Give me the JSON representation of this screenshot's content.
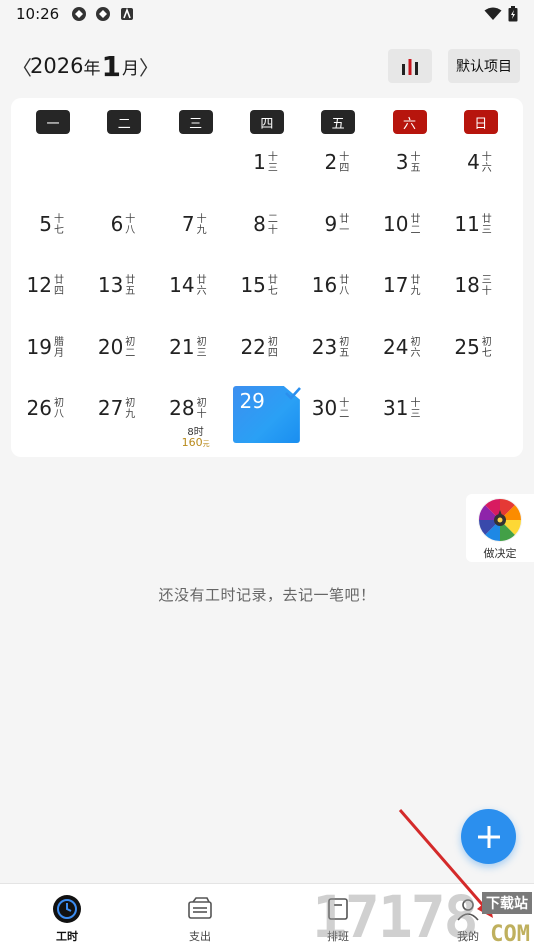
{
  "status_bar": {
    "time": "10:26"
  },
  "header": {
    "prev": "〈",
    "year": "2026",
    "year_unit": "年",
    "month": "1",
    "month_unit": "月",
    "next": "〉",
    "project_button": "默认项目"
  },
  "weekdays": [
    "一",
    "二",
    "三",
    "四",
    "五",
    "六",
    "日"
  ],
  "days": [
    {
      "day": "1",
      "lunar": "十三"
    },
    {
      "day": "2",
      "lunar": "十四"
    },
    {
      "day": "3",
      "lunar": "十五"
    },
    {
      "day": "4",
      "lunar": "十六"
    },
    {
      "day": "5",
      "lunar": "十七"
    },
    {
      "day": "6",
      "lunar": "十八"
    },
    {
      "day": "7",
      "lunar": "十九"
    },
    {
      "day": "8",
      "lunar": "二十"
    },
    {
      "day": "9",
      "lunar": "廿一"
    },
    {
      "day": "10",
      "lunar": "廿二"
    },
    {
      "day": "11",
      "lunar": "廿三"
    },
    {
      "day": "12",
      "lunar": "廿四"
    },
    {
      "day": "13",
      "lunar": "廿五"
    },
    {
      "day": "14",
      "lunar": "廿六"
    },
    {
      "day": "15",
      "lunar": "廿七"
    },
    {
      "day": "16",
      "lunar": "廿八"
    },
    {
      "day": "17",
      "lunar": "廿九"
    },
    {
      "day": "18",
      "lunar": "三十"
    },
    {
      "day": "19",
      "lunar": "腊月"
    },
    {
      "day": "20",
      "lunar": "初二"
    },
    {
      "day": "21",
      "lunar": "初三"
    },
    {
      "day": "22",
      "lunar": "初四"
    },
    {
      "day": "23",
      "lunar": "初五"
    },
    {
      "day": "24",
      "lunar": "初六"
    },
    {
      "day": "25",
      "lunar": "初七"
    },
    {
      "day": "26",
      "lunar": "初八"
    },
    {
      "day": "27",
      "lunar": "初九"
    },
    {
      "day": "28",
      "lunar": "初十",
      "hours": "8时",
      "amount": "160",
      "amount_unit": "元"
    },
    {
      "day": "29",
      "lunar": "",
      "selected": true
    },
    {
      "day": "30",
      "lunar": "十二"
    },
    {
      "day": "31",
      "lunar": "十三"
    }
  ],
  "decide": {
    "label": "做决定"
  },
  "empty_message": "还没有工时记录，去记一笔吧！",
  "bottom_nav": [
    {
      "label": "工时",
      "icon": "clock-icon",
      "active": true
    },
    {
      "label": "支出",
      "icon": "wallet-icon",
      "active": false
    },
    {
      "label": "排班",
      "icon": "schedule-icon",
      "active": false
    },
    {
      "label": "我的",
      "icon": "profile-icon",
      "active": false
    }
  ],
  "watermark": {
    "number": "17178",
    "tag": "下载站",
    "domain": "COM"
  },
  "colors": {
    "accent": "#2b8fee",
    "weekend": "#b7150d",
    "weekday": "#262626",
    "amount": "#b88a1b"
  }
}
